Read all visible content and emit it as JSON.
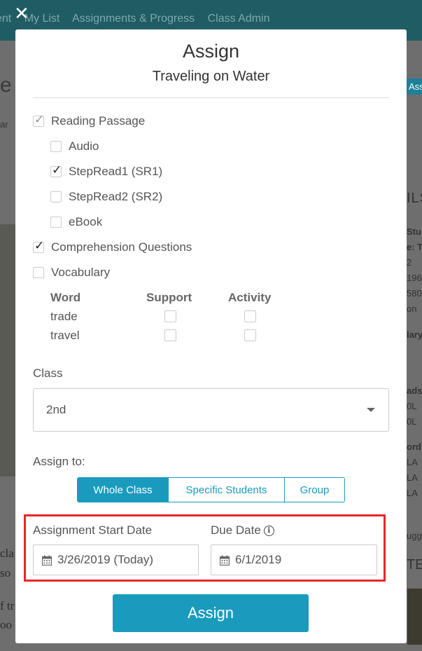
{
  "background": {
    "nav": [
      "ent",
      "My List",
      "Assignments & Progress",
      "Class Admin"
    ],
    "left_fragments": [
      "e",
      "ar",
      "cla",
      "so",
      "f tr",
      "oo"
    ],
    "right_fragments": [
      "Ass",
      "ILS",
      "Stud",
      "e: T",
      "2",
      "196",
      "580",
      "on",
      "lary",
      "ads",
      "0L",
      "0L",
      "ords",
      "LA",
      "LA",
      "LA",
      "ugg",
      "TE"
    ]
  },
  "modal": {
    "title": "Assign",
    "subtitle": "Traveling on Water",
    "reading_passage": {
      "label": "Reading Passage",
      "checked": true
    },
    "sub_options": [
      {
        "label": "Audio",
        "checked": false
      },
      {
        "label": "StepRead1 (SR1)",
        "checked": true
      },
      {
        "label": "StepRead2 (SR2)",
        "checked": false
      },
      {
        "label": "eBook",
        "checked": false
      }
    ],
    "comprehension": {
      "label": "Comprehension Questions",
      "checked": true
    },
    "vocabulary": {
      "label": "Vocabulary",
      "checked": false,
      "headers": {
        "word": "Word",
        "support": "Support",
        "activity": "Activity"
      },
      "rows": [
        {
          "word": "trade",
          "support": false,
          "activity": false
        },
        {
          "word": "travel",
          "support": false,
          "activity": false
        }
      ]
    },
    "class_label": "Class",
    "class_value": "2nd",
    "assign_to_label": "Assign to:",
    "assign_to_options": [
      "Whole Class",
      "Specific Students",
      "Group"
    ],
    "assign_to_selected": "Whole Class",
    "start_date_label": "Assignment Start Date",
    "start_date_value": "3/26/2019 (Today)",
    "due_date_label": "Due Date",
    "due_date_value": "6/1/2019",
    "assign_button": "Assign"
  },
  "colors": {
    "accent": "#1a9bbd",
    "highlight": "#e8262b"
  }
}
